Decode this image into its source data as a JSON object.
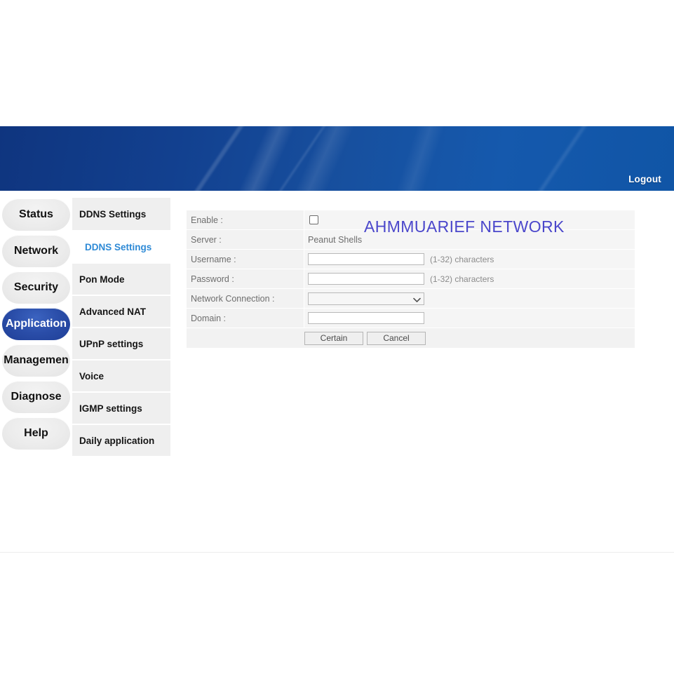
{
  "header": {
    "logout_label": "Logout",
    "banner_color_left": "#0f357f",
    "banner_color_right": "#1559ad"
  },
  "sidebar": {
    "items": [
      {
        "label": "Status",
        "active": false
      },
      {
        "label": "Network",
        "active": false
      },
      {
        "label": "Security",
        "active": false
      },
      {
        "label": "Application",
        "active": true
      },
      {
        "label": "Managemen",
        "active": false
      },
      {
        "label": "Diagnose",
        "active": false
      },
      {
        "label": "Help",
        "active": false
      }
    ],
    "active_color": "#2a4da8"
  },
  "submenu": {
    "items": [
      {
        "label": "DDNS Settings",
        "selected": false
      },
      {
        "label": "DDNS Settings",
        "selected": true
      },
      {
        "label": "Pon Mode",
        "selected": false
      },
      {
        "label": "Advanced NAT",
        "selected": false
      },
      {
        "label": "UPnP settings",
        "selected": false
      },
      {
        "label": "Voice",
        "selected": false
      },
      {
        "label": "IGMP settings",
        "selected": false
      },
      {
        "label": "Daily application",
        "selected": false
      }
    ],
    "selected_color": "#2e8ad6"
  },
  "form": {
    "rows": {
      "enable": {
        "label": "Enable :",
        "checked": false
      },
      "server": {
        "label": "Server :",
        "value": "Peanut Shells"
      },
      "username": {
        "label": "Username :",
        "value": "",
        "hint": "(1-32) characters"
      },
      "password": {
        "label": "Password :",
        "value": "",
        "hint": "(1-32) characters"
      },
      "network_connection": {
        "label": "Network Connection :",
        "value": "",
        "options": [
          ""
        ]
      },
      "domain": {
        "label": "Domain :",
        "value": ""
      }
    },
    "buttons": {
      "confirm_label": "Certain",
      "cancel_label": "Cancel"
    }
  },
  "watermark": {
    "text": "AHMMUARIEF NETWORK",
    "color": "#4b47cb"
  }
}
